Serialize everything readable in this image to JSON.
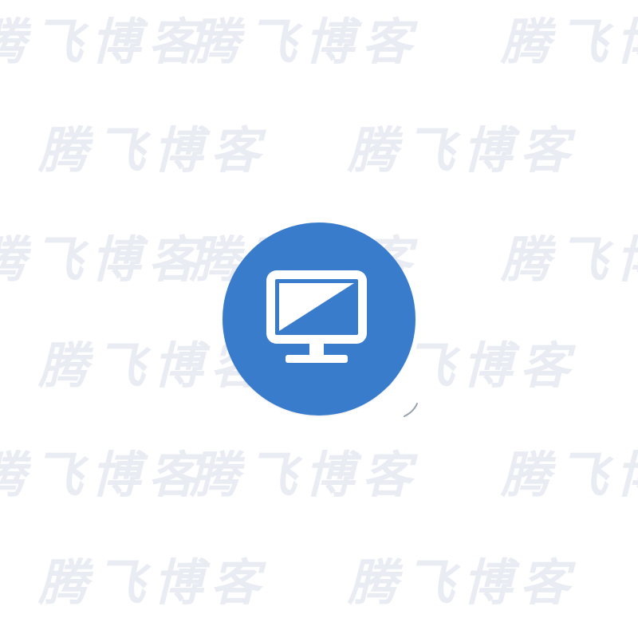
{
  "watermark": {
    "text": "腾飞博客",
    "color": "#e9ecf3"
  },
  "icon": {
    "name": "monitor-icon",
    "background_color": "#3a7ccc",
    "glyph_color": "#ffffff"
  }
}
